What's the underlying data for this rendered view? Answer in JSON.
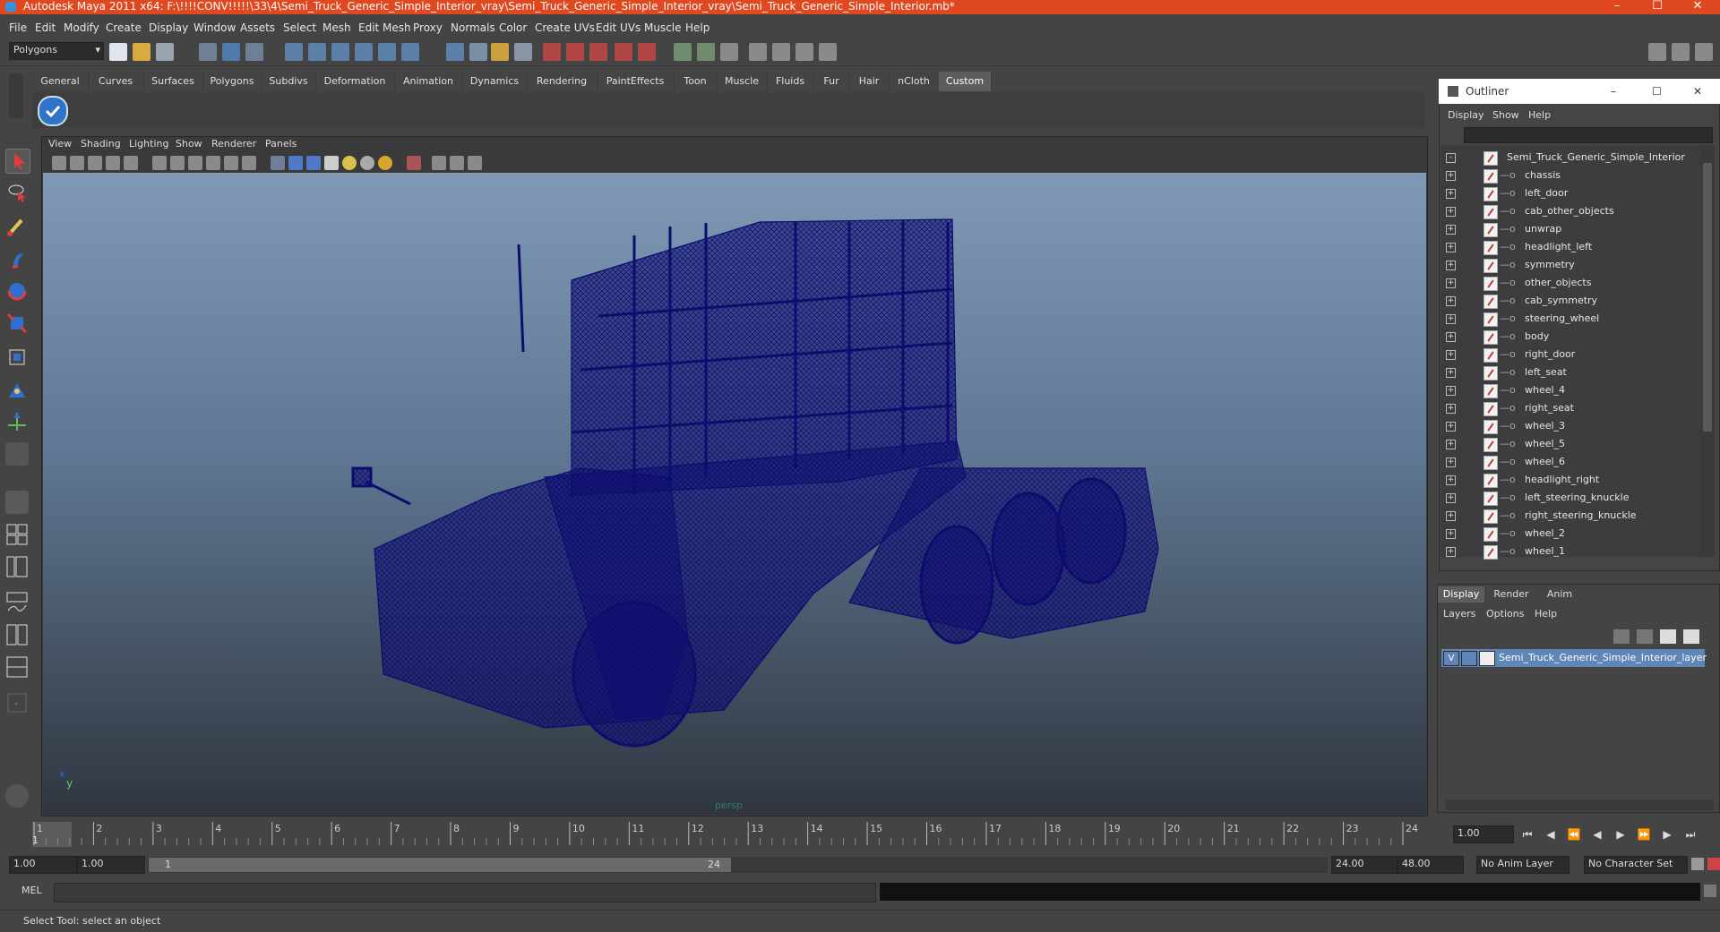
{
  "window": {
    "title": "Autodesk Maya 2011 x64: F:\\!!!!CONV!!!!!\\33\\4\\Semi_Truck_Generic_Simple_Interior_vray\\Semi_Truck_Generic_Simple_Interior_vray\\Semi_Truck_Generic_Simple_Interior.mb*",
    "title_bar_color": "#e0481f"
  },
  "menubar": [
    "File",
    "Edit",
    "Modify",
    "Create",
    "Display",
    "Window",
    "Assets",
    "Select",
    "Mesh",
    "Edit Mesh",
    "Proxy",
    "Normals",
    "Color",
    "Create UVs",
    "Edit UVs",
    "Muscle",
    "Help"
  ],
  "status_line": {
    "mode": "Polygons"
  },
  "shelf_tabs": [
    "General",
    "Curves",
    "Surfaces",
    "Polygons",
    "Subdivs",
    "Deformation",
    "Animation",
    "Dynamics",
    "Rendering",
    "PaintEffects",
    "Toon",
    "Muscle",
    "Fluids",
    "Fur",
    "Hair",
    "nCloth",
    "Custom"
  ],
  "shelf_active_tab": "Custom",
  "viewport": {
    "menu": [
      "View",
      "Shading",
      "Lighting",
      "Show",
      "Renderer",
      "Panels"
    ],
    "camera_label": "persp",
    "axis_y": "y",
    "axis_x": "x",
    "wireframe_color": "#0d0d6e"
  },
  "outliner": {
    "title": "Outliner",
    "menu": [
      "Display",
      "Show",
      "Help"
    ],
    "root": "Semi_Truck_Generic_Simple_Interior",
    "items": [
      "chassis",
      "left_door",
      "cab_other_objects",
      "unwrap",
      "headlight_left",
      "symmetry",
      "other_objects",
      "cab_symmetry",
      "steering_wheel",
      "body",
      "right_door",
      "left_seat",
      "wheel_4",
      "right_seat",
      "wheel_3",
      "wheel_5",
      "wheel_6",
      "headlight_right",
      "left_steering_knuckle",
      "right_steering_knuckle",
      "wheel_2",
      "wheel_1"
    ]
  },
  "layer_editor": {
    "tabs": [
      "Display",
      "Render",
      "Anim"
    ],
    "active_tab": "Display",
    "menu": [
      "Layers",
      "Options",
      "Help"
    ],
    "layer_visibility": "V",
    "layer_name": "Semi_Truck_Generic_Simple_Interior_layer"
  },
  "timeline": {
    "ticks": [
      "1",
      "2",
      "3",
      "4",
      "5",
      "6",
      "7",
      "8",
      "9",
      "10",
      "11",
      "12",
      "13",
      "14",
      "15",
      "16",
      "17",
      "18",
      "19",
      "20",
      "21",
      "22",
      "23",
      "24"
    ],
    "current_frame": "1.00",
    "current_marker": "1"
  },
  "range_slider": {
    "start": "1.00",
    "playback_start": "1.00",
    "range_start_label": "1",
    "range_end_label": "24",
    "playback_end": "24.00",
    "end": "48.00",
    "anim_layer": "No Anim Layer",
    "character_set": "No Character Set"
  },
  "command_line": {
    "label": "MEL"
  },
  "help_line": {
    "text": "Select Tool: select an object"
  }
}
